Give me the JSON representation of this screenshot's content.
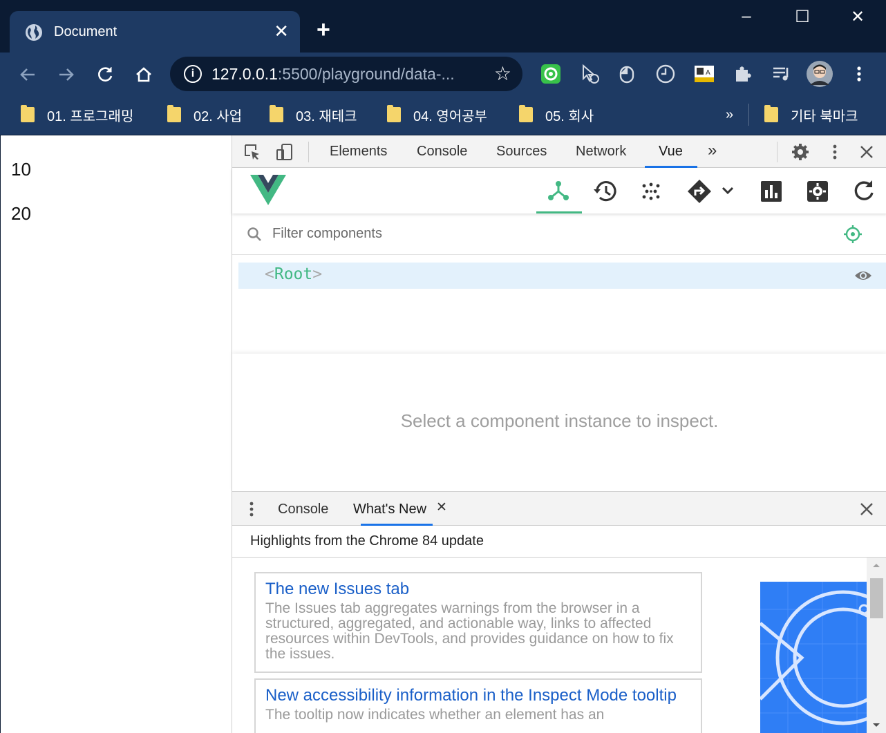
{
  "browser": {
    "tab_title": "Document",
    "tab_close": "✕",
    "new_tab": "+",
    "url_host": "127.0.0.1",
    "url_rest": ":5500/playground/data-...",
    "window_minimize": "–",
    "window_maximize": "☐",
    "window_close": "✕"
  },
  "bookmarks": {
    "items": [
      {
        "label": "01. 프로그래밍"
      },
      {
        "label": "02. 사업"
      },
      {
        "label": "03. 재테크"
      },
      {
        "label": "04. 영어공부"
      },
      {
        "label": "05. 회사"
      }
    ],
    "overflow": "»",
    "other": "기타 북마크"
  },
  "page": {
    "values": [
      "10",
      "20"
    ]
  },
  "devtools": {
    "tabs": [
      "Elements",
      "Console",
      "Sources",
      "Network",
      "Vue"
    ],
    "active_tab": "Vue",
    "more": "»",
    "filter_placeholder": "Filter components",
    "root_open": "<",
    "root_name": "Root",
    "root_close": ">",
    "inspect_message": "Select a component instance to inspect.",
    "drawer_tabs": [
      "Console",
      "What's New"
    ],
    "drawer_close_tab": "✕",
    "highlights_title": "Highlights from the Chrome 84 update",
    "news": [
      {
        "title": "The new Issues tab",
        "desc": "The Issues tab aggregates warnings from the browser in a structured, aggregated, and actionable way, links to affected resources within DevTools, and provides guidance on how to fix the issues."
      },
      {
        "title": "New accessibility information in the Inspect Mode tooltip",
        "desc": "The tooltip now indicates whether an element has an"
      }
    ]
  },
  "colors": {
    "vue_green": "#42b883",
    "vue_dark": "#35495e",
    "link_blue": "#1a5fc8",
    "tab_accent": "#1a73e8"
  }
}
